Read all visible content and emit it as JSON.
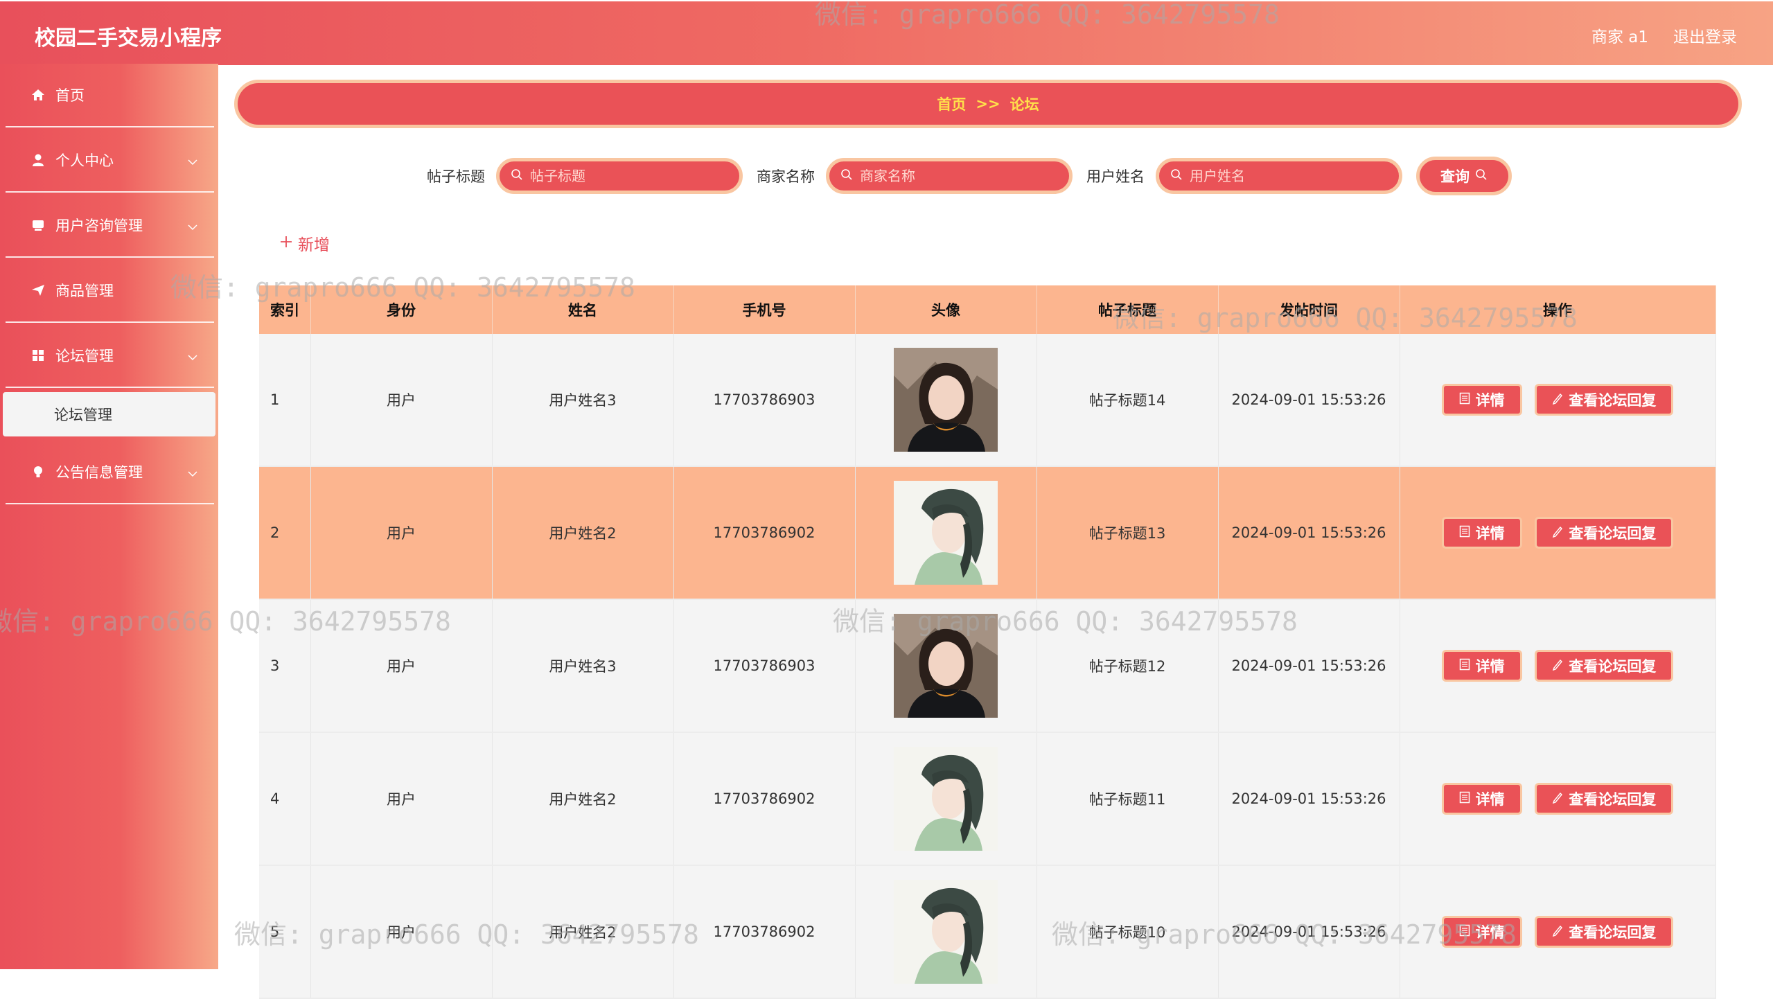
{
  "header": {
    "title": "校园二手交易小程序",
    "user": "商家 a1",
    "logout": "退出登录"
  },
  "sidebar": {
    "items": [
      {
        "label": "首页",
        "icon": "home-icon"
      },
      {
        "label": "个人中心",
        "icon": "user-icon"
      },
      {
        "label": "用户咨询管理",
        "icon": "chat-icon"
      },
      {
        "label": "商品管理",
        "icon": "send-icon"
      },
      {
        "label": "论坛管理",
        "icon": "grid-icon"
      },
      {
        "label": "公告信息管理",
        "icon": "bulb-icon"
      }
    ],
    "submenu": {
      "label": "论坛管理"
    }
  },
  "breadcrumb": {
    "home": "首页",
    "sep": ">>",
    "current": "论坛"
  },
  "search": {
    "title_label": "帖子标题",
    "title_placeholder": "帖子标题",
    "merchant_label": "商家名称",
    "merchant_placeholder": "商家名称",
    "user_label": "用户姓名",
    "user_placeholder": "用户姓名",
    "query": "查询"
  },
  "add_label": "新增",
  "table": {
    "headers": [
      "索引",
      "身份",
      "姓名",
      "手机号",
      "头像",
      "帖子标题",
      "发帖时间",
      "操作"
    ],
    "rows": [
      {
        "index": "1",
        "role": "用户",
        "name": "用户姓名3",
        "phone": "17703786903",
        "title": "帖子标题14",
        "time": "2024-09-01 15:53:26"
      },
      {
        "index": "2",
        "role": "用户",
        "name": "用户姓名2",
        "phone": "17703786902",
        "title": "帖子标题13",
        "time": "2024-09-01 15:53:26"
      },
      {
        "index": "3",
        "role": "用户",
        "name": "用户姓名3",
        "phone": "17703786903",
        "title": "帖子标题12",
        "time": "2024-09-01 15:53:26"
      },
      {
        "index": "4",
        "role": "用户",
        "name": "用户姓名2",
        "phone": "17703786902",
        "title": "帖子标题11",
        "time": "2024-09-01 15:53:26"
      },
      {
        "index": "5",
        "role": "用户",
        "name": "用户姓名2",
        "phone": "17703786902",
        "title": "帖子标题10",
        "time": "2024-09-01 15:53:26"
      }
    ],
    "detail_label": "详情",
    "reply_label": "查看论坛回复"
  },
  "watermark": "微信: grapro666 QQ: 3642795578",
  "colors": {
    "primary": "#ea5257",
    "accent": "#fcb58f",
    "border": "#f9c6a1",
    "crumb_text": "#ffe14a"
  }
}
